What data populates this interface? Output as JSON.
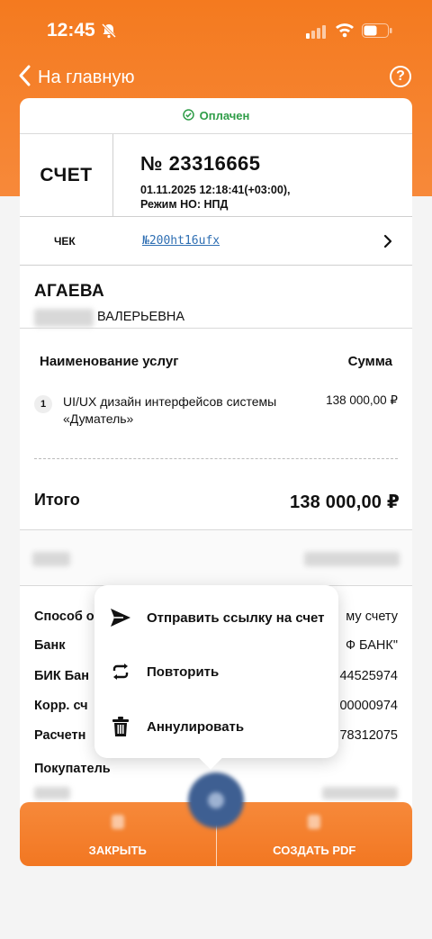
{
  "status_bar": {
    "time": "12:45"
  },
  "nav": {
    "back_label": "На главную",
    "help_label": "?"
  },
  "invoice": {
    "status": "Оплачен",
    "type_label": "СЧЕТ",
    "number": "№ 23316665",
    "datetime": "01.11.2025 12:18:41(+03:00),",
    "tax_mode": "Режим НО: НПД",
    "receipt_label": "ЧЕК",
    "receipt_link": "№200ht16ufx"
  },
  "client": {
    "surname": "АГАЕВА",
    "patronymic": "ВАЛЕРЬЕВНА"
  },
  "services": {
    "header_name": "Наименование услуг",
    "header_sum": "Сумма",
    "items": [
      {
        "num": "1",
        "name": "UI/UX дизайн интерфейсов системы «Думатель»",
        "price": "138 000,00 ₽"
      }
    ]
  },
  "total": {
    "label": "Итого",
    "value": "138 000,00 ₽"
  },
  "details": {
    "payment_method_label": "Способ о",
    "payment_method_value": "му счету",
    "bank_label": "Банк",
    "bank_value": "Ф БАНК\"",
    "bik_label": "БИК Бан",
    "bik_value": "44525974",
    "corr_label": "Корр. сч",
    "corr_value": "00000974",
    "account_label": "Расчетн",
    "account_value": "78312075",
    "buyer_label": "Покупатель"
  },
  "context_menu": {
    "items": [
      {
        "label": "Отправить ссылку на счет",
        "icon": "send-icon"
      },
      {
        "label": "Повторить",
        "icon": "repeat-icon"
      },
      {
        "label": "Аннулировать",
        "icon": "trash-icon"
      }
    ]
  },
  "bottom_bar": {
    "close_label": "ЗАКРЫТЬ",
    "pdf_label": "СОЗДАТЬ PDF"
  },
  "colors": {
    "accent": "#f47a1f",
    "paid": "#2f9d48",
    "link": "#2f6fb3"
  }
}
